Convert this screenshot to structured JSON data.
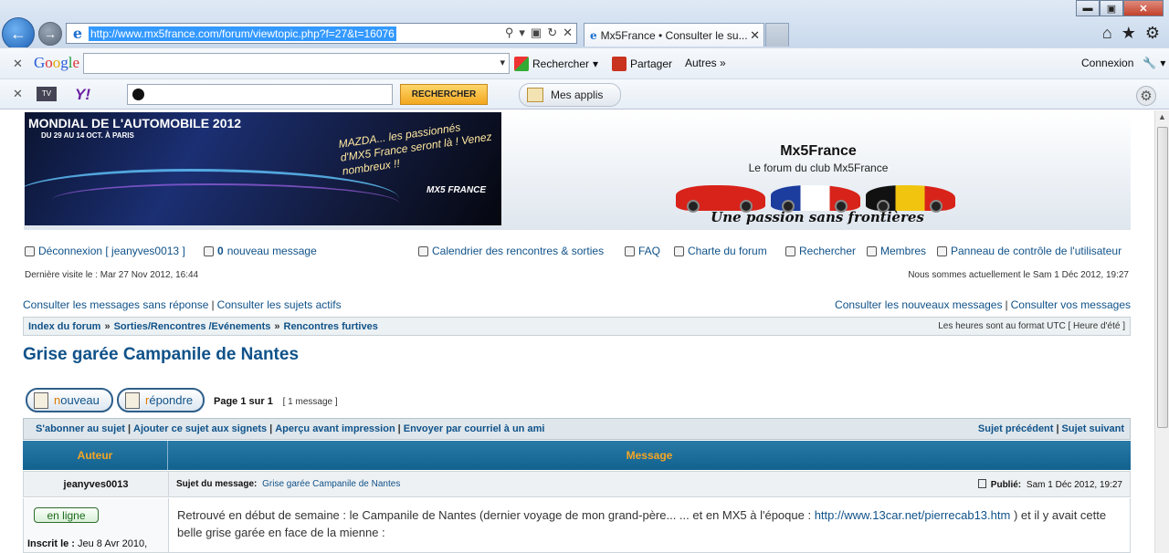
{
  "browser": {
    "url": "http://www.mx5france.com/forum/viewtopic.php?f=27&t=16076",
    "tab_title": "Mx5France • Consulter le su...",
    "window_buttons": {
      "minimize": "▬",
      "maximize": "▣",
      "close": "✕"
    }
  },
  "google_toolbar": {
    "search_label": "Rechercher",
    "share_label": "Partager",
    "more_label": "Autres »",
    "login_label": "Connexion"
  },
  "yahoo_toolbar": {
    "logo": "Y!",
    "search_button": "RECHERCHER",
    "apps_label": "Mes applis"
  },
  "header": {
    "banner_title": "MONDIAL DE L'AUTOMOBILE 2012",
    "banner_dates": "DU 29 AU 14 OCT. À PARIS",
    "banner_text": "MAZDA... les passionnés d'MX5 France seront là ! Venez nombreux !!",
    "banner_logo": "MX5 FRANCE",
    "site_title": "Mx5France",
    "site_subtitle": "Le forum du club Mx5France",
    "slogan": "Une passion sans frontières"
  },
  "menu": {
    "logout": "Déconnexion [ jeanyves0013 ]",
    "new_messages_count": "0",
    "new_messages_label": "nouveau message",
    "calendar": "Calendrier des rencontres & sorties",
    "faq": "FAQ",
    "charter": "Charte du forum",
    "search": "Rechercher",
    "members": "Membres",
    "ucp": "Panneau de contrôle de l'utilisateur"
  },
  "info": {
    "last_visit": "Dernière visite le : Mar 27 Nov 2012, 16:44",
    "now": "Nous sommes actuellement le Sam 1 Déc 2012, 19:27"
  },
  "quick_links": {
    "unanswered": "Consulter les messages sans réponse",
    "active": "Consulter les sujets actifs",
    "new_posts": "Consulter les nouveaux messages",
    "your_posts": "Consulter vos messages"
  },
  "breadcrumb": {
    "items": [
      "Index du forum",
      "Sorties/Rencontres /Evénements",
      "Rencontres furtives"
    ],
    "timezone": "Les heures sont au format UTC [ Heure d'été ]"
  },
  "topic": {
    "title": "Grise garée Campanile de Nantes",
    "btn_new_first": "n",
    "btn_new_rest": "ouveau",
    "btn_reply_first": "r",
    "btn_reply_rest": "épondre",
    "page_info": "Page 1 sur 1",
    "message_count": "[ 1 message ]"
  },
  "topic_actions": {
    "subscribe": "S'abonner au sujet",
    "bookmark": "Ajouter ce sujet aux signets",
    "print": "Aperçu avant impression",
    "email": "Envoyer par courriel à un ami",
    "previous": "Sujet précédent",
    "next": "Sujet suivant"
  },
  "post": {
    "col_author": "Auteur",
    "col_message": "Message",
    "author": "jeanyves0013",
    "subject_label": "Sujet du message:",
    "subject": "Grise garée Campanile de Nantes",
    "posted_label": "Publié:",
    "posted_date": "Sam 1 Déc 2012, 19:27",
    "online_label": "en ligne",
    "registered_label": "Inscrit le :",
    "registered_date": "Jeu 8 Avr 2010,",
    "body_start": "Retrouvé en début de semaine : le Campanile de Nantes (dernier voyage de mon grand-père... ... et en MX5 à l'époque :",
    "body_link": "http://www.13car.net/pierrecab13.htm",
    "body_end": ") et il y avait cette belle grise garée en face de la mienne :"
  }
}
